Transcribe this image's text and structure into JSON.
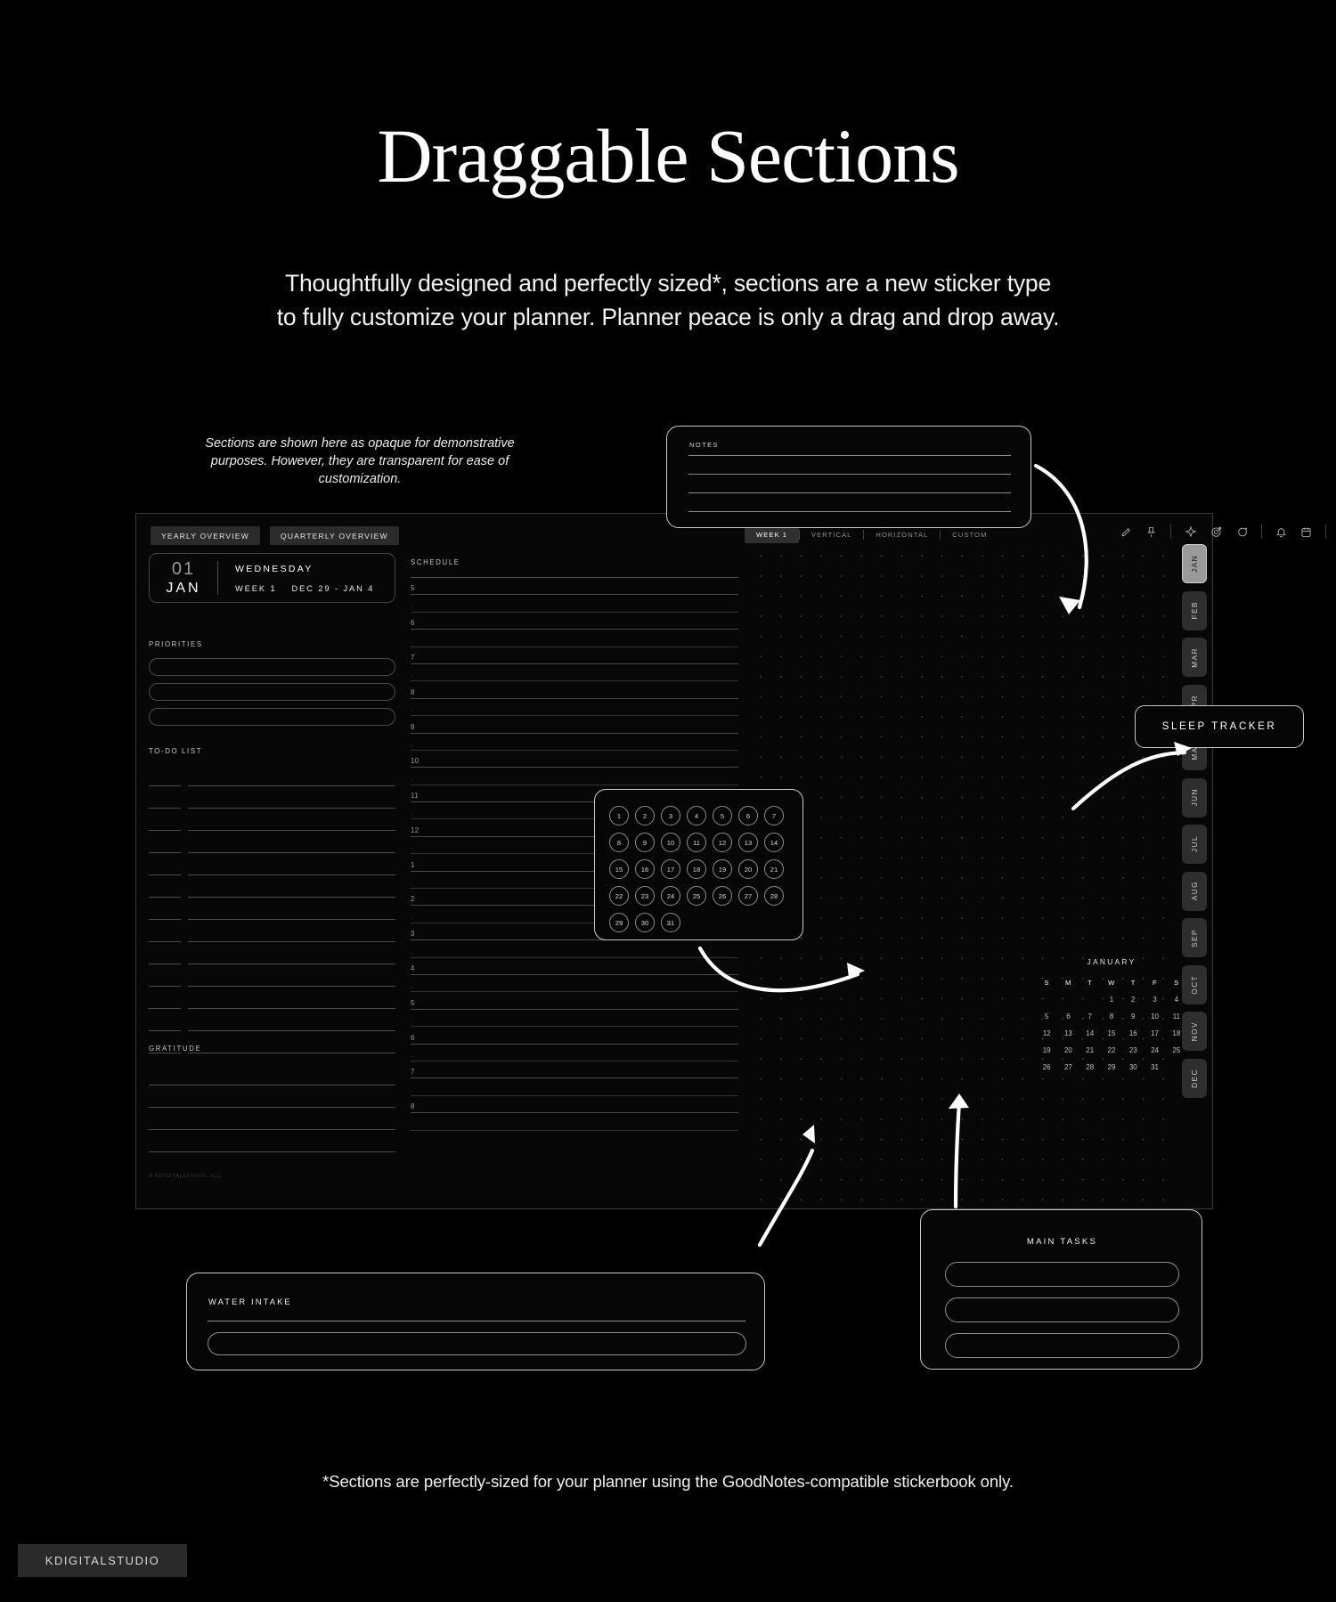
{
  "hero": {
    "title": "Draggable Sections",
    "subtitle": "Thoughtfully designed and perfectly sized*, sections are a new sticker type\nto fully customize your planner. Planner peace is only a drag and drop away."
  },
  "demo_note": "Sections are shown here as opaque for demonstrative purposes. However, they are transparent for ease of customization.",
  "footer": {
    "note": "*Sections are perfectly-sized for your planner using the GoodNotes-compatible stickerbook only.",
    "brand": "KDIGITALSTUDIO"
  },
  "planner": {
    "overview_tabs": [
      "YEARLY OVERVIEW",
      "QUARTERLY OVERVIEW"
    ],
    "view_tabs": [
      {
        "label": "WEEK 1",
        "active": true
      },
      {
        "label": "VERTICAL",
        "active": false
      },
      {
        "label": "HORIZONTAL",
        "active": false
      },
      {
        "label": "CUSTOM",
        "active": false
      }
    ],
    "toolbar_icons": [
      "pencil-icon",
      "pin-icon",
      "sparkle-icon",
      "target-icon",
      "chat-icon",
      "bell-icon",
      "calendar-icon",
      "menu-icon"
    ],
    "date_card": {
      "day": "01",
      "month": "JAN",
      "weekday": "WEDNESDAY",
      "week": "WEEK 1",
      "range": "DEC 29 - JAN 4"
    },
    "priorities": {
      "label": "PRIORITIES",
      "rows": 3
    },
    "todo": {
      "label": "TO-DO LIST",
      "rows": 13
    },
    "gratitude": {
      "label": "GRATITUDE",
      "rows": 4
    },
    "schedule": {
      "label": "SCHEDULE",
      "hours": [
        "5",
        "6",
        "7",
        "8",
        "9",
        "10",
        "11",
        "12",
        "1",
        "2",
        "3",
        "4",
        "5",
        "6",
        "7",
        "8"
      ]
    },
    "months": [
      "JAN",
      "FEB",
      "MAR",
      "APR",
      "MAY",
      "JUN",
      "JUL",
      "AUG",
      "SEP",
      "OCT",
      "NOV",
      "DEC"
    ],
    "active_month": "JAN",
    "mini_calendar": {
      "title": "JANUARY",
      "dow": [
        "S",
        "M",
        "T",
        "W",
        "T",
        "F",
        "S"
      ],
      "lead_blank": 3,
      "days": [
        1,
        2,
        3,
        4,
        5,
        6,
        7,
        8,
        9,
        10,
        11,
        12,
        13,
        14,
        15,
        16,
        17,
        18,
        19,
        20,
        21,
        22,
        23,
        24,
        25,
        26,
        27,
        28,
        29,
        30,
        31
      ]
    },
    "copyright": "© KDIGITALSTUDIO, LLC"
  },
  "stickers": {
    "notes": {
      "label": "NOTES",
      "lines": 4
    },
    "dates": {
      "days": [
        1,
        2,
        3,
        4,
        5,
        6,
        7,
        8,
        9,
        10,
        11,
        12,
        13,
        14,
        15,
        16,
        17,
        18,
        19,
        20,
        21,
        22,
        23,
        24,
        25,
        26,
        27,
        28,
        29,
        30,
        31
      ]
    },
    "sleep_tracker": {
      "label": "SLEEP TRACKER"
    },
    "water_intake": {
      "label": "WATER INTAKE"
    },
    "main_tasks": {
      "label": "MAIN TASKS",
      "rows": 3
    }
  },
  "colors": {
    "background": "#000000",
    "sticker_border": "#c9c9c9",
    "panel_border": "#3a3a3a",
    "accent_active": "#9a9a9a"
  }
}
